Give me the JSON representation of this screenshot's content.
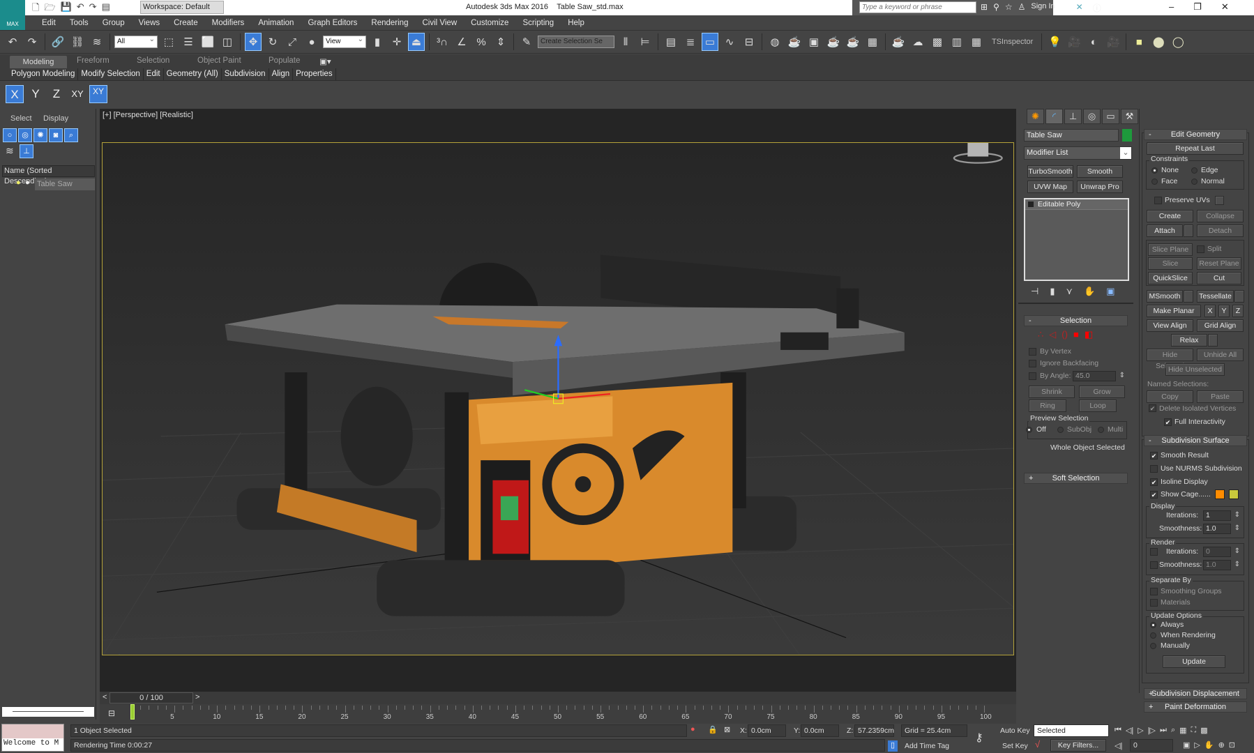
{
  "title_bar": {
    "app_label": "MAX",
    "workspace": "Workspace: Default",
    "title": "Autodesk 3ds Max 2016",
    "file": "Table Saw_std.max",
    "search_placeholder": "Type a keyword or phrase",
    "sign_in": "Sign In"
  },
  "menu": [
    "Edit",
    "Tools",
    "Group",
    "Views",
    "Create",
    "Modifiers",
    "Animation",
    "Graph Editors",
    "Rendering",
    "Civil View",
    "Customize",
    "Scripting",
    "Help"
  ],
  "toolbar": {
    "selection_filter": "All",
    "ref_coord": "View",
    "named_selection": "Create Selection Se",
    "ts_inspector": "TSInspector"
  },
  "ribbon": {
    "tabs": [
      "Modeling",
      "Freeform",
      "Selection",
      "Object Paint",
      "Populate"
    ],
    "panels": [
      "Polygon Modeling",
      "Modify Selection",
      "Edit",
      "Geometry (All)",
      "Subdivision",
      "Align",
      "Properties"
    ]
  },
  "axis_constraints": [
    "X",
    "Y",
    "Z",
    "XY",
    "XY"
  ],
  "scene_explorer": {
    "tabs": [
      "Select",
      "Display"
    ],
    "column_header": "Name (Sorted Descending)",
    "items": [
      "Table Saw"
    ]
  },
  "viewport": {
    "label": "[+] [Perspective] [Realistic]"
  },
  "command_panel": {
    "object_name": "Table Saw",
    "object_color": "#1e9a3c",
    "modifier_list": "Modifier List",
    "modifier_buttons": [
      "TurboSmooth",
      "Smooth",
      "UVW Map",
      "Unwrap Pro"
    ],
    "stack": [
      "Editable Poly"
    ],
    "selection": {
      "title": "Selection",
      "by_vertex": "By Vertex",
      "ignore_backfacing": "Ignore Backfacing",
      "by_angle": "By Angle:",
      "angle": "45.0",
      "shrink": "Shrink",
      "grow": "Grow",
      "ring": "Ring",
      "loop": "Loop",
      "preview": "Preview Selection",
      "off": "Off",
      "subobj": "SubObj",
      "multi": "Multi",
      "status": "Whole Object Selected"
    },
    "soft_selection": "Soft Selection",
    "edit_geometry": {
      "title": "Edit Geometry",
      "repeat_last": "Repeat Last",
      "constraints": "Constraints",
      "none": "None",
      "edge": "Edge",
      "face": "Face",
      "normal": "Normal",
      "preserve_uvs": "Preserve UVs",
      "create": "Create",
      "collapse": "Collapse",
      "attach": "Attach",
      "detach": "Detach",
      "slice_plane": "Slice Plane",
      "split": "Split",
      "slice": "Slice",
      "reset_plane": "Reset Plane",
      "quickslice": "QuickSlice",
      "cut": "Cut",
      "msmooth": "MSmooth",
      "tessellate": "Tessellate",
      "make_planar": "Make Planar",
      "x": "X",
      "y": "Y",
      "z": "Z",
      "view_align": "View Align",
      "grid_align": "Grid Align",
      "relax": "Relax",
      "hide_selected": "Hide Selected",
      "unhide_all": "Unhide All",
      "hide_unselected": "Hide Unselected",
      "named_selections": "Named Selections:",
      "copy": "Copy",
      "paste": "Paste",
      "delete_isolated": "Delete Isolated Vertices",
      "full_interactivity": "Full Interactivity"
    },
    "subdivision_surface": {
      "title": "Subdivision Surface",
      "smooth_result": "Smooth Result",
      "use_nurms": "Use NURMS Subdivision",
      "isoline": "Isoline Display",
      "show_cage": "Show Cage......",
      "cage_color_1": "#ff8c00",
      "cage_color_2": "#c8c83c",
      "display": "Display",
      "iterations": "Iterations:",
      "smoothness": "Smoothness:",
      "display_iterations": "1",
      "display_smoothness": "1.0",
      "render": "Render",
      "render_iterations": "0",
      "render_smoothness": "1.0",
      "separate_by": "Separate By",
      "smoothing_groups": "Smoothing Groups",
      "materials": "Materials",
      "update_options": "Update Options",
      "always": "Always",
      "when_rendering": "When Rendering",
      "manually": "Manually",
      "update": "Update"
    },
    "subdivision_displacement": "Subdivision Displacement",
    "paint_deformation": "Paint Deformation"
  },
  "timeline": {
    "frame_label": "0 / 100",
    "prev": "<",
    "next": ">",
    "start": 0,
    "end": 100,
    "current": 0,
    "tick_labels": [
      "5",
      "10",
      "15",
      "20",
      "25",
      "30",
      "35",
      "40",
      "45",
      "50",
      "55",
      "60",
      "65",
      "70",
      "75",
      "80",
      "85",
      "90",
      "95",
      "100"
    ]
  },
  "status": {
    "maxscript": "Welcome to M",
    "selection": "1 Object Selected",
    "render_time": "Rendering Time  0:00:27",
    "x_label": "X:",
    "x": "0.0cm",
    "y_label": "Y:",
    "y": "0.0cm",
    "z_label": "Z:",
    "z": "57.2359cm",
    "grid": "Grid = 25.4cm",
    "add_time_tag": "Add Time Tag",
    "auto_key": "Auto Key",
    "key_mode": "Selected",
    "set_key": "Set Key",
    "key_filters": "Key Filters...",
    "frame": "0"
  }
}
